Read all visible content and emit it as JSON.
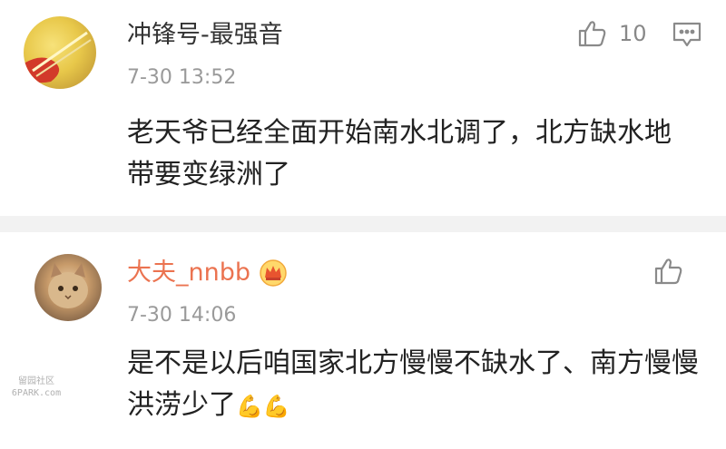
{
  "comments": [
    {
      "username": "冲锋号-最强音",
      "timestamp": "7-30 13:52",
      "text": "老天爷已经全面开始南水北调了，北方缺水地带要变绿洲了",
      "like_count": "10"
    },
    {
      "username": "大夫_nnbb",
      "timestamp": "7-30 14:06",
      "text": "是不是以后咱国家北方慢慢不缺水了、南方慢慢洪涝少了",
      "emoji": "💪💪"
    }
  ],
  "watermark": {
    "line1": "留园社区",
    "line2": "6PARK.com"
  },
  "colors": {
    "vip_name": "#eb7350",
    "name": "#333333",
    "meta": "#9a9a9a",
    "separator": "#f2f2f2"
  }
}
